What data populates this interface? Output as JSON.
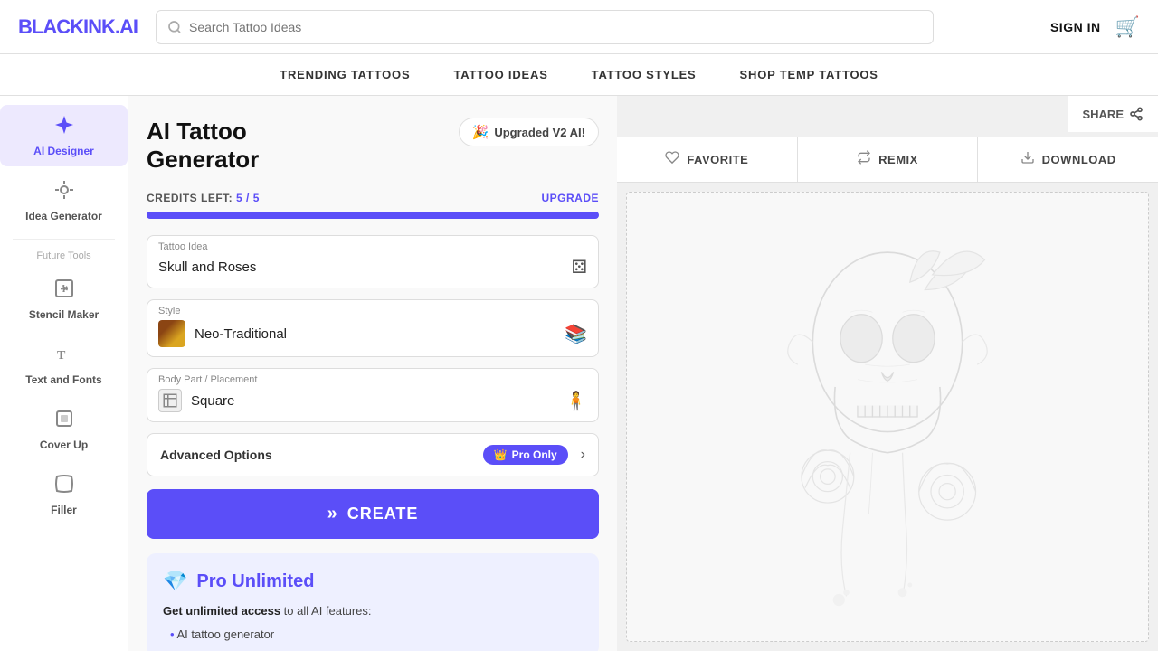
{
  "logo": {
    "black": "BLACK",
    "accent": "INK",
    "dot": ".AI"
  },
  "header": {
    "search_placeholder": "Search Tattoo Ideas",
    "sign_in": "SIGN IN"
  },
  "nav": {
    "items": [
      {
        "id": "trending",
        "label": "TRENDING TATTOOS"
      },
      {
        "id": "ideas",
        "label": "TATTOO IDEAS"
      },
      {
        "id": "styles",
        "label": "TATTOO STYLES"
      },
      {
        "id": "shop",
        "label": "SHOP TEMP TATTOOS"
      }
    ]
  },
  "sidebar": {
    "items": [
      {
        "id": "ai-designer",
        "label": "AI Designer",
        "icon": "✦",
        "active": true
      },
      {
        "id": "idea-generator",
        "label": "Idea Generator",
        "icon": "💡",
        "active": false
      },
      {
        "id": "stencil-maker",
        "label": "Stencil Maker",
        "icon": "⊞",
        "active": false
      },
      {
        "id": "text-fonts",
        "label": "Text and Fonts",
        "icon": "T",
        "active": false
      },
      {
        "id": "cover-up",
        "label": "Cover Up",
        "icon": "⊡",
        "active": false
      },
      {
        "id": "filler",
        "label": "Filler",
        "icon": "⠿",
        "active": false
      }
    ],
    "future_tools_label": "Future Tools"
  },
  "main": {
    "panel_title_line1": "AI Tattoo",
    "panel_title_line2": "Generator",
    "badge_v2": "Upgraded V2 AI!",
    "credits_label": "CREDITS LEFT:",
    "credits_current": "5",
    "credits_total": "5",
    "upgrade_label": "UPGRADE",
    "progress_pct": 100,
    "tattoo_idea_label": "Tattoo Idea",
    "tattoo_idea_value": "Skull and Roses",
    "style_label": "Style",
    "style_value": "Neo-Traditional",
    "body_part_label": "Body Part / Placement",
    "body_part_value": "Square",
    "advanced_options_label": "Advanced Options",
    "pro_only_label": "Pro Only",
    "create_label": "CREATE",
    "share_label": "SHARE",
    "favorite_label": "FAVORITE",
    "remix_label": "REMIX",
    "download_label": "DOWNLOAD"
  },
  "pro_card": {
    "title": "Pro Unlimited",
    "desc_strong": "Get unlimited access",
    "desc_rest": " to all AI features:",
    "features": [
      "AI tattoo generator"
    ]
  },
  "colors": {
    "brand": "#5b4ef8",
    "brand_light": "#ede9fe",
    "brand_bg": "#eef0ff"
  }
}
